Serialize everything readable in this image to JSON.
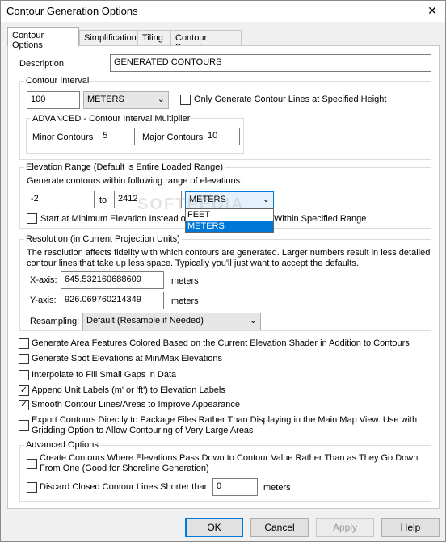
{
  "window": {
    "title": "Contour Generation Options",
    "close_glyph": "✕"
  },
  "tabs": [
    "Contour Options",
    "Simplification",
    "Tiling",
    "Contour Bounds"
  ],
  "description": {
    "label": "Description",
    "value": "GENERATED CONTOURS"
  },
  "contour_interval": {
    "group_label": "Contour Interval",
    "value": "100",
    "unit": "METERS",
    "only_specified_label": "Only Generate Contour Lines at Specified Height",
    "only_specified_checked": false,
    "advanced_label": "ADVANCED - Contour Interval Multiplier",
    "minor_label": "Minor Contours",
    "minor_value": "5",
    "major_label": "Major Contours",
    "major_value": "10"
  },
  "elevation_range": {
    "group_label": "Elevation Range (Default is Entire Loaded Range)",
    "desc": "Generate contours within following range of elevations:",
    "min": "-2",
    "to_label": "to",
    "max": "2412",
    "unit": "METERS",
    "unit_options": [
      "FEET",
      "METERS"
    ],
    "unit_selected_index": 1,
    "start_min_label_a": "Start at Minimum Elevation Instead of",
    "start_min_label_b": "Within Specified Range",
    "start_min_checked": false
  },
  "resolution": {
    "group_label": "Resolution (in Current Projection Units)",
    "desc_line1": "The resolution affects fidelity with which contours are generated. Larger numbers result in less detailed",
    "desc_line2": "contour lines that take up less space. Typically you'll just want to accept the defaults.",
    "x_label": "X-axis:",
    "x_value": "645.532160688609",
    "x_unit": "meters",
    "y_label": "Y-axis:",
    "y_value": "926.069760214349",
    "y_unit": "meters",
    "resampling_label": "Resampling:",
    "resampling_value": "Default (Resample if Needed)"
  },
  "options": [
    {
      "label": "Generate Area Features Colored Based on the Current Elevation Shader in Addition to Contours",
      "checked": false
    },
    {
      "label": "Generate Spot Elevations at Min/Max Elevations",
      "checked": false
    },
    {
      "label": "Interpolate to Fill Small Gaps in Data",
      "checked": false
    },
    {
      "label": "Append Unit Labels (m' or 'ft') to Elevation Labels",
      "checked": true
    },
    {
      "label": "Smooth Contour Lines/Areas to Improve Appearance",
      "checked": true
    },
    {
      "label": "Export Contours Directly to Package Files Rather Than Displaying in the Main Map View. Use with",
      "label2": "Gridding Option to Allow Contouring of Very Large Areas",
      "checked": false
    }
  ],
  "advanced": {
    "group_label": "Advanced Options",
    "create_label1": "Create Contours Where Elevations Pass Down to Contour Value Rather Than as They Go Down",
    "create_label2": "From One (Good for Shoreline Generation)",
    "create_checked": false,
    "discard_label": "Discard Closed Contour Lines Shorter than",
    "discard_checked": false,
    "discard_value": "0",
    "discard_unit": "meters"
  },
  "buttons": {
    "ok": "OK",
    "cancel": "Cancel",
    "apply": "Apply",
    "help": "Help"
  },
  "watermark": "SOFTPEDIA",
  "icons": {
    "chevron": "⌄",
    "check": "✓"
  },
  "colors": {
    "accent": "#0078d7",
    "selection": "#0078d7"
  }
}
